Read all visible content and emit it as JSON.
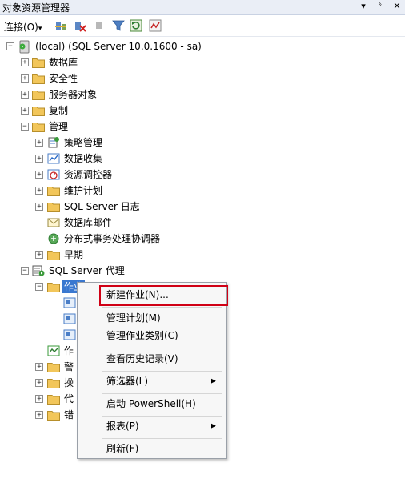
{
  "panel": {
    "title": "对象资源管理器",
    "pin": "▾",
    "dock": "ᚫ",
    "close": "✕"
  },
  "toolbar": {
    "connect_label": "连接(O)",
    "connect_arrow": "▾"
  },
  "tree": {
    "root": "(local) (SQL Server 10.0.1600 - sa)",
    "databases": "数据库",
    "security": "安全性",
    "server_objects": "服务器对象",
    "replication": "复制",
    "management": "管理",
    "policy_management": "策略管理",
    "data_collection": "数据收集",
    "resource_governor": "资源调控器",
    "maintenance_plans": "维护计划",
    "sql_server_logs": "SQL Server 日志",
    "database_mail": "数据库邮件",
    "dtc": "分布式事务处理协调器",
    "legacy": "早期",
    "agent": "SQL Server 代理",
    "jobs_partial": "作业",
    "job_activity_partial": "作",
    "alerts_partial": "警",
    "operators_partial": "操",
    "proxies_partial": "代",
    "error_logs_partial": "错"
  },
  "context_menu": {
    "new_job": "新建作业(N)...",
    "manage_schedules": "管理计划(M)",
    "manage_categories": "管理作业类别(C)",
    "view_history": "查看历史记录(V)",
    "filter": "筛选器(L)",
    "start_powershell": "启动 PowerShell(H)",
    "reports": "报表(P)",
    "refresh": "刷新(F)",
    "submenu_arrow": "▶"
  },
  "colors": {
    "highlight_border": "#d00015",
    "folder": "#f2c65a"
  }
}
